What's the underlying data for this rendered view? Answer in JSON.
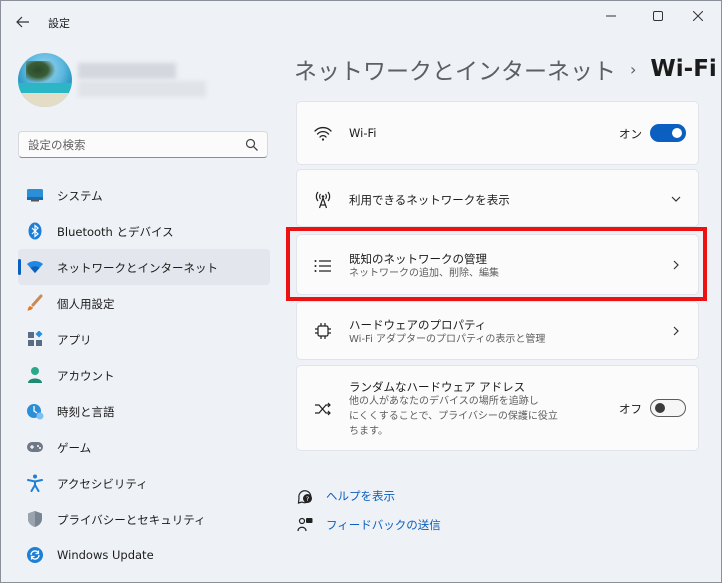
{
  "app": {
    "title": "設定"
  },
  "search": {
    "placeholder": "設定の検索"
  },
  "sidebar": {
    "items": [
      {
        "label": "システム",
        "icon": "system-icon"
      },
      {
        "label": "Bluetooth とデバイス",
        "icon": "bluetooth-icon"
      },
      {
        "label": "ネットワークとインターネット",
        "icon": "wifi-icon",
        "active": true
      },
      {
        "label": "個人用設定",
        "icon": "brush-icon"
      },
      {
        "label": "アプリ",
        "icon": "apps-icon"
      },
      {
        "label": "アカウント",
        "icon": "account-icon"
      },
      {
        "label": "時刻と言語",
        "icon": "time-language-icon"
      },
      {
        "label": "ゲーム",
        "icon": "gamepad-icon"
      },
      {
        "label": "アクセシビリティ",
        "icon": "accessibility-icon"
      },
      {
        "label": "プライバシーとセキュリティ",
        "icon": "shield-icon"
      },
      {
        "label": "Windows Update",
        "icon": "update-icon"
      }
    ]
  },
  "header": {
    "parent": "ネットワークとインターネット",
    "separator": "›",
    "current": "Wi-Fi"
  },
  "cards": {
    "wifi": {
      "title": "Wi-Fi",
      "toggle_label": "オン",
      "toggle_on": true
    },
    "available": {
      "title": "利用できるネットワークを表示"
    },
    "known": {
      "title": "既知のネットワークの管理",
      "subtitle": "ネットワークの追加、削除、編集"
    },
    "hardware": {
      "title": "ハードウェアのプロパティ",
      "subtitle": "Wi-Fi アダプターのプロパティの表示と管理"
    },
    "random": {
      "title": "ランダムなハードウェア アドレス",
      "subtitle_lines": [
        "他の人があなたのデバイスの場所を追跡し",
        "にくくすることで、プライバシーの保護に役立",
        "ちます。"
      ],
      "toggle_label": "オフ",
      "toggle_on": false
    }
  },
  "links": {
    "help": "ヘルプを表示",
    "feedback": "フィードバックの送信"
  },
  "colors": {
    "accent": "#0a5fc0",
    "highlight": "#ee1111",
    "background": "#eef1f6",
    "card": "#fbfbfc"
  }
}
